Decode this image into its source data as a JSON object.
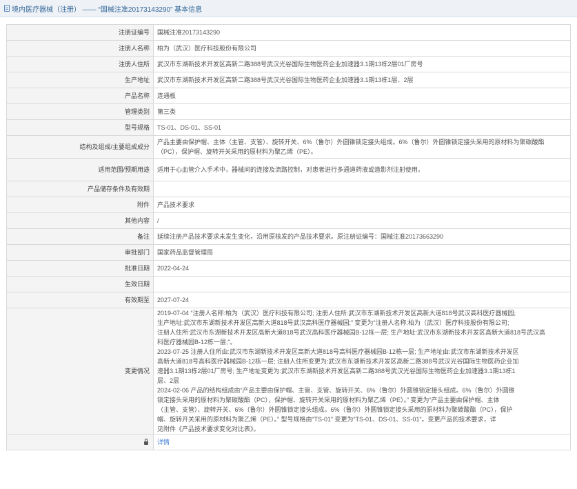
{
  "header": {
    "title": "境内医疗器械（注册） —— “国械注准20173143290” 基本信息"
  },
  "rows": [
    {
      "label": "注册证编号",
      "value": "国械注准20173143290"
    },
    {
      "label": "注册人名称",
      "value": "柏为（武汉）医疗科技股份有限公司"
    },
    {
      "label": "注册人住所",
      "value": "武汉市东湖新技术开发区高新二路388号武汉光谷国际生物医药企业加速器3.1期13栋2层01厂房号"
    },
    {
      "label": "生产地址",
      "value": "武汉市东湖新技术开发区高新二路388号武汉光谷国际生物医药企业加速器3.1期13栋1层、2层"
    },
    {
      "label": "产品名称",
      "value": "连通板"
    },
    {
      "label": "管理类别",
      "value": "第三类"
    },
    {
      "label": "型号规格",
      "value": "TS-01、DS-01、SS-01"
    },
    {
      "label": "结构及组成/主要组成成分",
      "value": "产品主要由保护帽、主体（主管、支管）、旋转开关、6%（鲁尔）外圆锥锁定接头组成。6%（鲁尔）外圆锥锁定接头采用的原材料为聚碳酸酯（PC），保护帽、旋转开关采用的原材料为聚乙烯（PE）。"
    },
    {
      "label": "适用范围/预期用途",
      "value": "适用于心血管介入手术中，器械间的连接及流路控制，对患者进行多通道药液或造影剂注射使用。"
    },
    {
      "label": "产品储存条件及有效期",
      "value": ""
    },
    {
      "label": "附件",
      "value": "产品技术要求"
    },
    {
      "label": "其他内容",
      "value": "/"
    },
    {
      "label": "备注",
      "value": "延续注册产品技术要求未发生变化，沿用原核发的产品技术要求。原注册证编号：国械注准20173663290"
    },
    {
      "label": "审批部门",
      "value": "国家药品监督管理局"
    },
    {
      "label": "批准日期",
      "value": "2022-04-24"
    },
    {
      "label": "生效日期",
      "value": ""
    },
    {
      "label": "有效期至",
      "value": "2027-07-24"
    }
  ],
  "changes": {
    "label": "变更情况",
    "lines": [
      "2019-07-04  “注册人名称:柏为（武汉）医疗科技有限公司; 注册人住所:武汉市东湖新技术开发区高新大道818号武汉高科医疗器械园;",
      "生产地址:武汉市东湖新技术开发区高新大道818号武汉高科医疗器械园;” 变更为“注册人名称:柏为（武汉）医疗科技股份有限公司;",
      "注册人住所:武汉市东湖新技术开发区高新大道818号武汉高科医疗器械园B-12栋一层; 生产地址:武汉市东湖新技术开发区高新大道818号武汉高",
      "科医疗器械园B-12栋一层;”。",
      "2023-07-25  注册人住所由:武汉市东湖新技术开发区高新大道818号高科医疗器械园B-12栋一层; 生产地址由:武汉市东湖新技术开发区",
      "高新大道818号高科医疗器械园B-12栋一层; 注册人住所变更为:武汉市东湖新技术开发区高新二路388号武汉光谷国际生物医药企业加",
      "速器3.1期13栋2层01厂房号; 生产地址变更为:武汉市东湖新技术开发区高新二路388号武汉光谷国际生物医药企业加速器3.1期13栋1",
      "层、2层",
      "2024-02-06  产品的结构组成由“产品主要由保护帽、主管、支管、旋转开关、6%（鲁尔）外圆锥锁定接头组成。6%（鲁尔）外圆锥",
      "锁定接头采用的原材料为聚碳酸酯（PC），保护帽、旋转开关采用的原材料为聚乙烯（PE）。” 变更为“产品主要由保护帽、主体",
      "（主管、支管）、旋转开关、6%（鲁尔）外圆锥锁定接头组成。6%（鲁尔）外圆锥锁定接头采用的原材料为聚碳酸酯（PC），保护",
      "帽、旋转开关采用的原材料为聚乙烯（PE）。” 型号规格由“TS-01” 变更为“TS-01、DS-01、SS-01”。变更产品的技术要求，详",
      "见附件《产品技术要求变化对比表》。"
    ]
  },
  "footer": {
    "label": "",
    "link": "详情"
  }
}
